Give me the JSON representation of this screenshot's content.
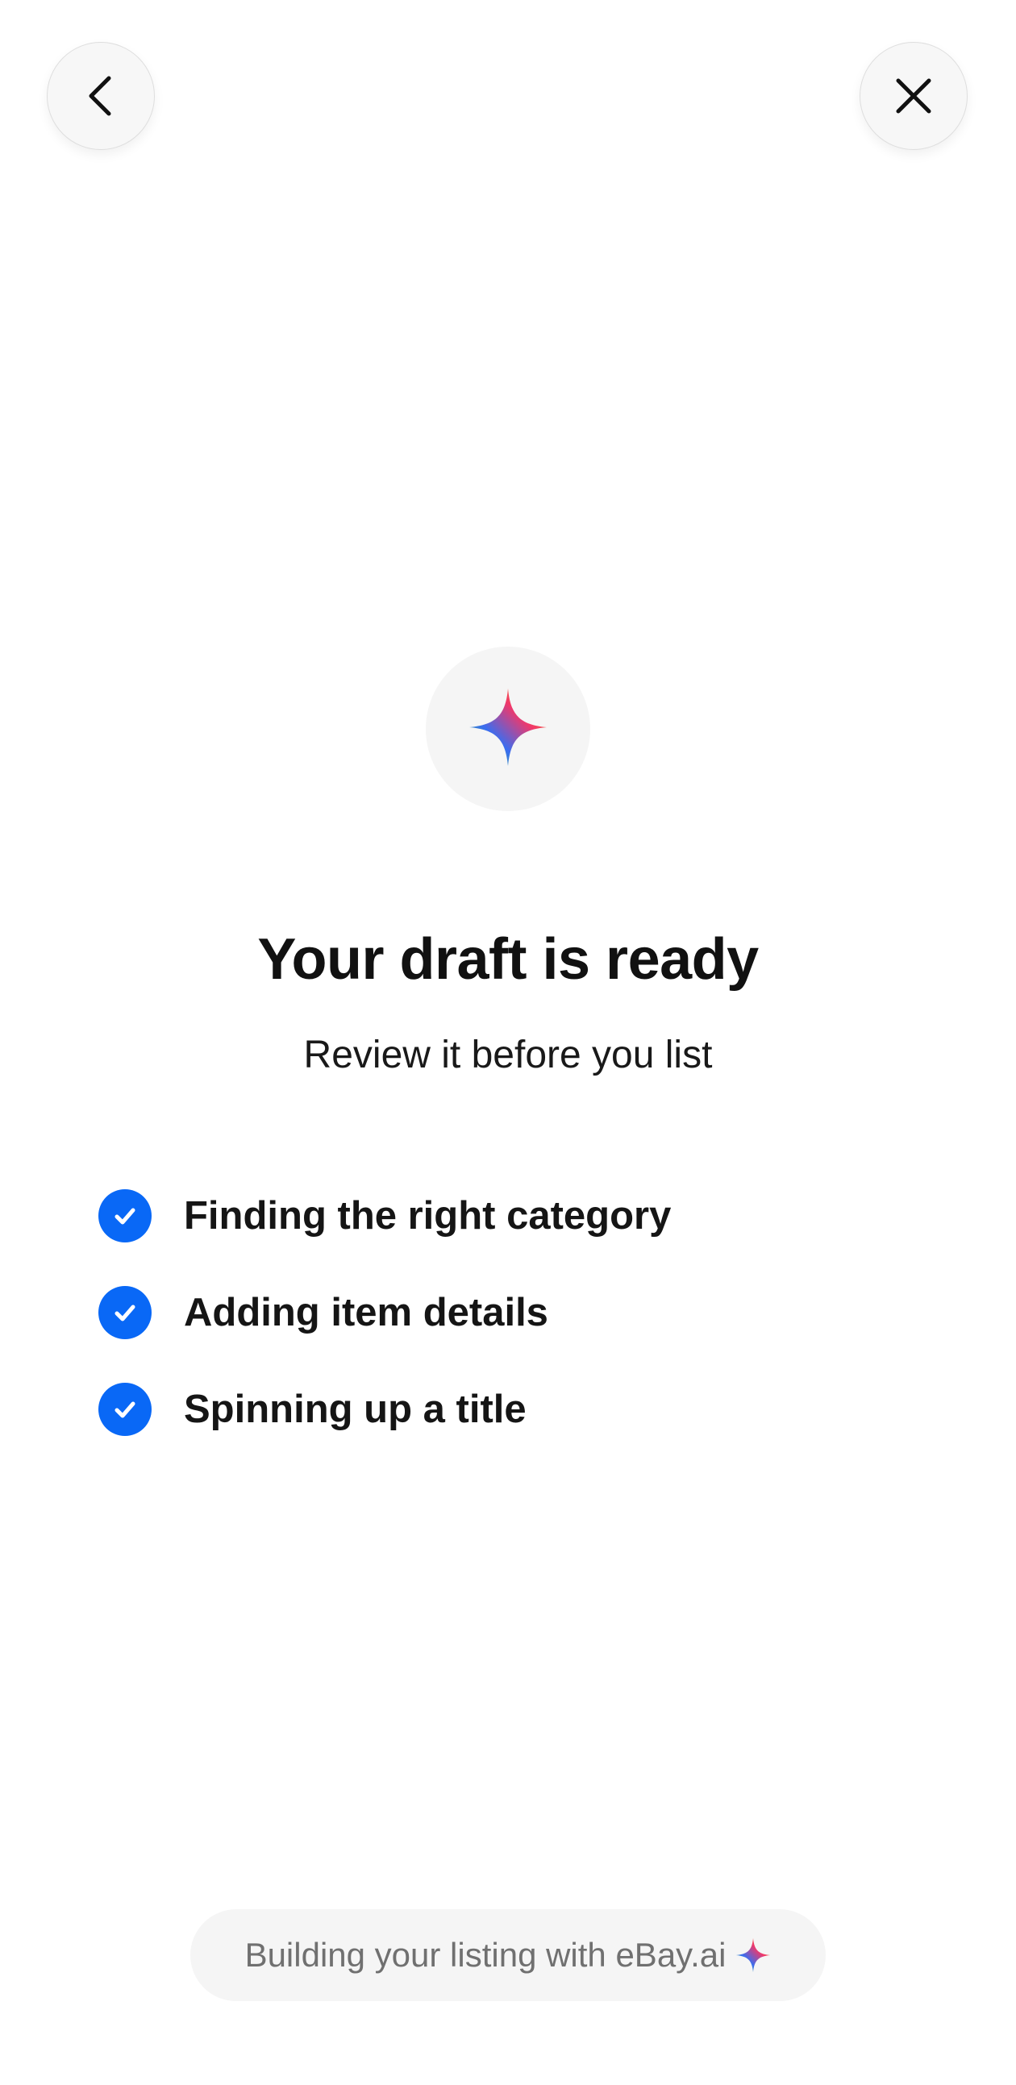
{
  "header": {
    "back_icon": "chevron-left-icon",
    "close_icon": "close-icon"
  },
  "hero": {
    "icon": "sparkle-icon",
    "title": "Your draft is ready",
    "subtitle": "Review it before you list"
  },
  "steps": [
    {
      "label": "Finding the right category",
      "status": "complete",
      "icon": "check-circle-icon"
    },
    {
      "label": "Adding item details",
      "status": "complete",
      "icon": "check-circle-icon"
    },
    {
      "label": "Spinning up a title",
      "status": "complete",
      "icon": "check-circle-icon"
    }
  ],
  "footer": {
    "text": "Building your listing with eBay.ai",
    "icon": "sparkle-icon"
  },
  "colors": {
    "accent": "#0968f6",
    "text_primary": "#111111",
    "text_secondary": "#707070",
    "surface": "#f5f5f5",
    "background": "#ffffff"
  }
}
